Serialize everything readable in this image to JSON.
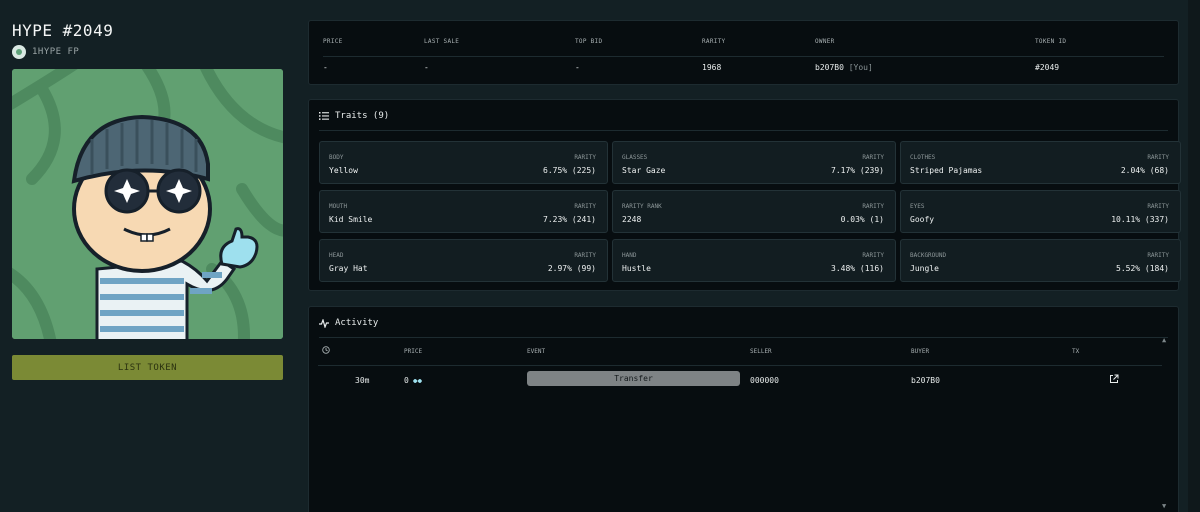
{
  "token": {
    "title": "HYPE #2049",
    "collection": "1HYPE FP",
    "list_button": "LIST TOKEN"
  },
  "info": {
    "headers": [
      "PRICE",
      "LAST SALE",
      "TOP BID",
      "RARITY",
      "OWNER",
      "TOKEN ID"
    ],
    "price": "-",
    "last_sale": "-",
    "top_bid": "-",
    "rarity": "1968",
    "owner": "b207B0",
    "owner_you": "[You]",
    "token_id": "#2049"
  },
  "traits": {
    "heading": "Traits (9)",
    "rarity_label": "RARITY",
    "items": [
      {
        "type": "BODY",
        "value": "Yellow",
        "rarity": "6.75% (225)"
      },
      {
        "type": "GLASSES",
        "value": "Star Gaze",
        "rarity": "7.17% (239)"
      },
      {
        "type": "CLOTHES",
        "value": "Striped Pajamas",
        "rarity": "2.04% (68)"
      },
      {
        "type": "MOUTH",
        "value": "Kid Smile",
        "rarity": "7.23% (241)"
      },
      {
        "type": "RARITY RANK",
        "value": "2248",
        "rarity": "0.03% (1)"
      },
      {
        "type": "EYES",
        "value": "Goofy",
        "rarity": "10.11% (337)"
      },
      {
        "type": "HEAD",
        "value": "Gray Hat",
        "rarity": "2.97% (99)"
      },
      {
        "type": "HAND",
        "value": "Hustle",
        "rarity": "3.48% (116)"
      },
      {
        "type": "BACKGROUND",
        "value": "Jungle",
        "rarity": "5.52% (184)"
      }
    ]
  },
  "activity": {
    "heading": "Activity",
    "columns": {
      "price": "PRICE",
      "event": "EVENT",
      "seller": "SELLER",
      "buyer": "BUYER",
      "tx": "TX"
    },
    "rows": [
      {
        "time": "30m",
        "price": "0",
        "event": "Transfer",
        "seller": "000000",
        "buyer": "b207B0"
      }
    ]
  },
  "colors": {
    "background": "#132024",
    "panel": "#070d10",
    "list_button": "#7b8a35",
    "nft_background": "#61a071"
  }
}
